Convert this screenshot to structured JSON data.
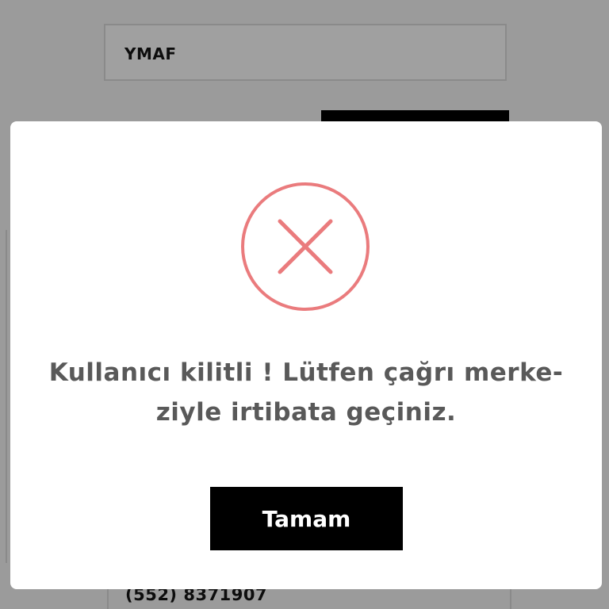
{
  "background": {
    "field_value": "YMAF",
    "phone_text": "(552) 8371907"
  },
  "modal": {
    "icon": "error-x-circle-icon",
    "icon_color": "#ea7b7d",
    "message_line1": "Kullanıcı kilitli ! Lütfen çağrı merke-",
    "message_line2": "ziyle irtibata geçiniz.",
    "ok_label": "Tamam"
  },
  "colors": {
    "overlay": "#9b9b9b",
    "modal_bg": "#ffffff",
    "button_bg": "#000000",
    "text": "#595959"
  }
}
